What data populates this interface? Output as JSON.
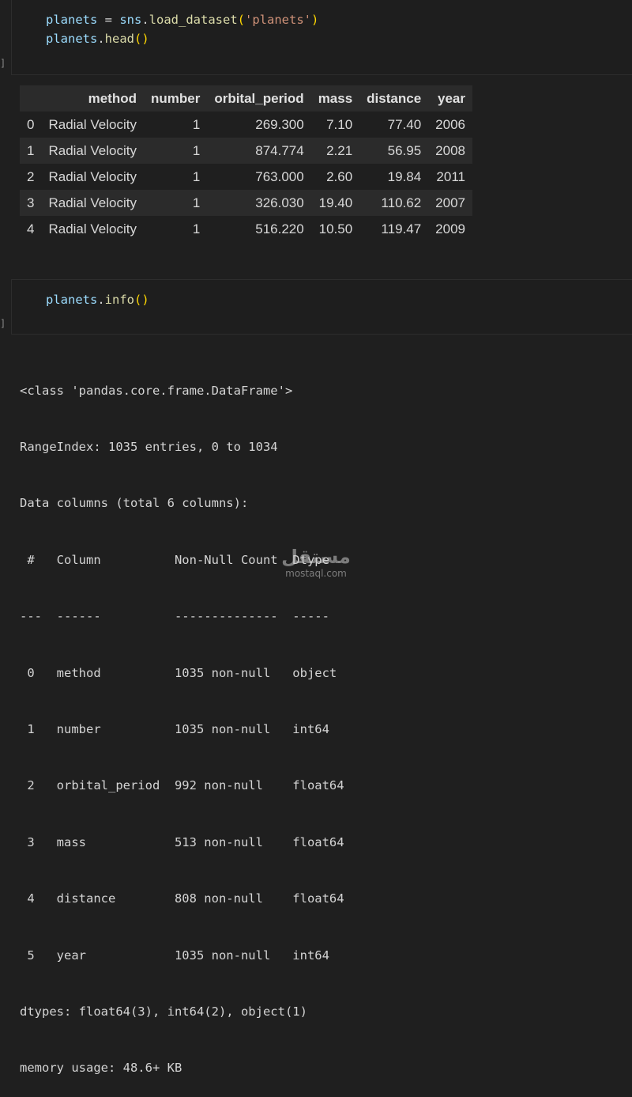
{
  "cells": {
    "cell1": {
      "bracket": "]",
      "code": {
        "line1": {
          "var": "planets",
          "op": " = ",
          "obj": "sns",
          "dot": ".",
          "fn": "load_dataset",
          "open": "(",
          "str": "'planets'",
          "close": ")"
        },
        "line2": {
          "var": "planets",
          "dot": ".",
          "fn": "head",
          "open": "(",
          "close": ")"
        }
      }
    },
    "cell2": {
      "bracket": "]",
      "code": {
        "line1": {
          "var": "planets",
          "dot": ".",
          "fn": "info",
          "open": "(",
          "close": ")"
        }
      }
    }
  },
  "dataframe": {
    "columns": [
      "",
      "method",
      "number",
      "orbital_period",
      "mass",
      "distance",
      "year"
    ],
    "rows": [
      [
        "0",
        "Radial Velocity",
        "1",
        "269.300",
        "7.10",
        "77.40",
        "2006"
      ],
      [
        "1",
        "Radial Velocity",
        "1",
        "874.774",
        "2.21",
        "56.95",
        "2008"
      ],
      [
        "2",
        "Radial Velocity",
        "1",
        "763.000",
        "2.60",
        "19.84",
        "2011"
      ],
      [
        "3",
        "Radial Velocity",
        "1",
        "326.030",
        "19.40",
        "110.62",
        "2007"
      ],
      [
        "4",
        "Radial Velocity",
        "1",
        "516.220",
        "10.50",
        "119.47",
        "2009"
      ]
    ]
  },
  "info_output": {
    "lines": [
      "<class 'pandas.core.frame.DataFrame'>",
      "RangeIndex: 1035 entries, 0 to 1034",
      "Data columns (total 6 columns):",
      " #   Column          Non-Null Count  Dtype  ",
      "---  ------          --------------  -----  ",
      " 0   method          1035 non-null   object ",
      " 1   number          1035 non-null   int64  ",
      " 2   orbital_period  992 non-null    float64",
      " 3   mass            513 non-null    float64",
      " 4   distance        808 non-null    float64",
      " 5   year            1035 non-null   int64  ",
      "dtypes: float64(3), int64(2), object(1)",
      "memory usage: 48.6+ KB"
    ]
  },
  "watermark": {
    "arabic": "مستقل",
    "latin": "mostaql.com"
  }
}
